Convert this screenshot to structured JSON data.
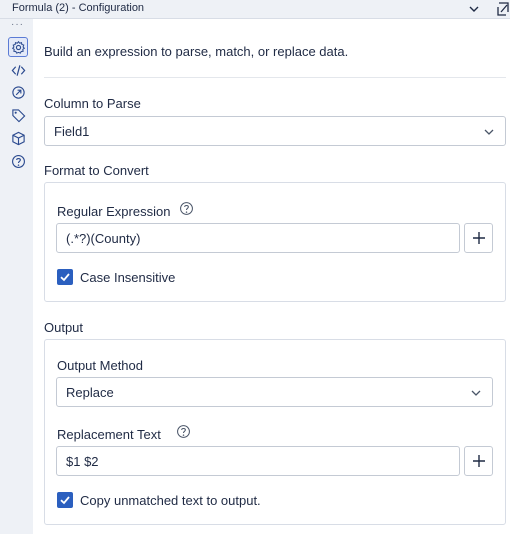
{
  "window": {
    "title": "Formula (2) - Configuration"
  },
  "rail": {
    "more": "···"
  },
  "intro": "Build an expression to parse, match, or replace data.",
  "column_to_parse": {
    "label": "Column to Parse",
    "value": "Field1"
  },
  "format_to_convert": {
    "label": "Format to Convert",
    "regex_label": "Regular Expression",
    "regex_value": "(.*?)(County)",
    "case_insensitive": {
      "label": "Case Insensitive",
      "checked": true
    }
  },
  "output": {
    "label": "Output",
    "method_label": "Output Method",
    "method_value": "Replace",
    "replacement_label": "Replacement Text",
    "replacement_value": "$1 $2",
    "copy_unmatched": {
      "label": "Copy unmatched text to output.",
      "checked": true
    }
  },
  "colors": {
    "accent": "#2b5fbf",
    "rail": "#eef1f6",
    "border": "#c4cad4"
  }
}
